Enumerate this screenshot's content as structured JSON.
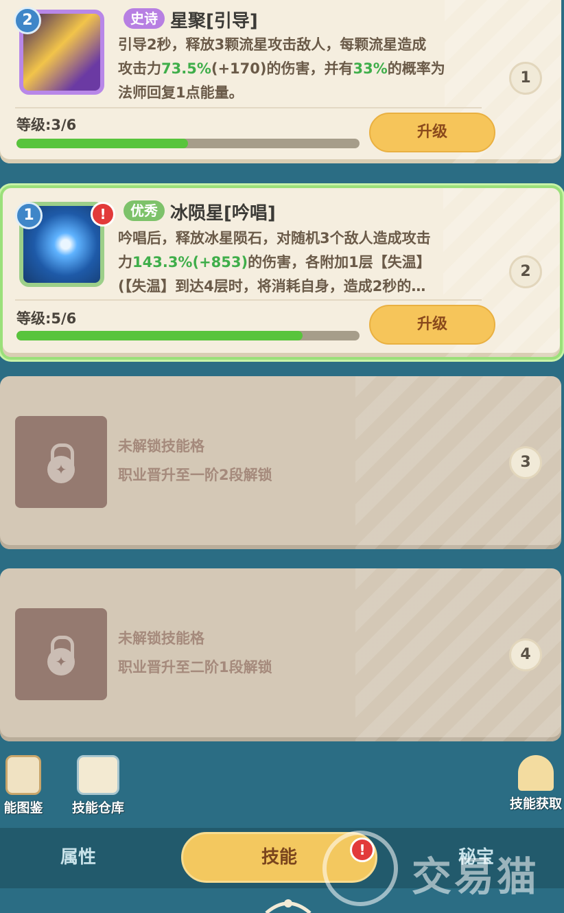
{
  "skills": [
    {
      "level_badge": "2",
      "rarity": "史诗",
      "name": "星聚[引导]",
      "desc_lines": [
        [
          "引导2秒，释放3颗流星攻击敌人，每颗流星造成"
        ],
        [
          "攻击力",
          "73.5%",
          "(+170)",
          "的伤害，并有",
          "33%",
          "的概率为"
        ],
        [
          "法师回复1点能量。"
        ]
      ],
      "level_text": "等级:3/6",
      "level_progress": 0.5,
      "upgrade_label": "升级",
      "slot_number": "1",
      "icon": "meteor-icon"
    },
    {
      "level_badge": "1",
      "alert": "!",
      "rarity": "优秀",
      "name": "冰陨星[吟唱]",
      "desc_lines": [
        [
          "吟唱后，释放冰星陨石，对随机3个敌人造成攻击"
        ],
        [
          "力",
          "143.3%",
          "(+853)",
          "的伤害，各附加1层【失温】"
        ],
        [
          "(【失温】到达4层时，将消耗自身，造成2秒的…"
        ]
      ],
      "level_text": "等级:5/6",
      "level_progress": 0.833,
      "upgrade_label": "升级",
      "slot_number": "2",
      "icon": "ice-meteor-icon"
    }
  ],
  "locked_slots": [
    {
      "title": "未解锁技能格",
      "condition": "职业晋升至一阶2段解锁",
      "slot_number": "3"
    },
    {
      "title": "未解锁技能格",
      "condition": "职业晋升至二阶1段解锁",
      "slot_number": "4"
    }
  ],
  "tools": {
    "codex": "能图鉴",
    "warehouse": "技能仓库",
    "obtain": "技能获取"
  },
  "tabs": {
    "attributes": "属性",
    "skills": "技能",
    "treasure": "秘宝",
    "skills_alert": "!"
  },
  "watermark": "交易猫",
  "colors": {
    "background": "#2b6d84",
    "card": "#f5eedf",
    "upgrade": "#f6c55a",
    "progress": "#58c43c",
    "highlight_value": "#3fae4a"
  }
}
